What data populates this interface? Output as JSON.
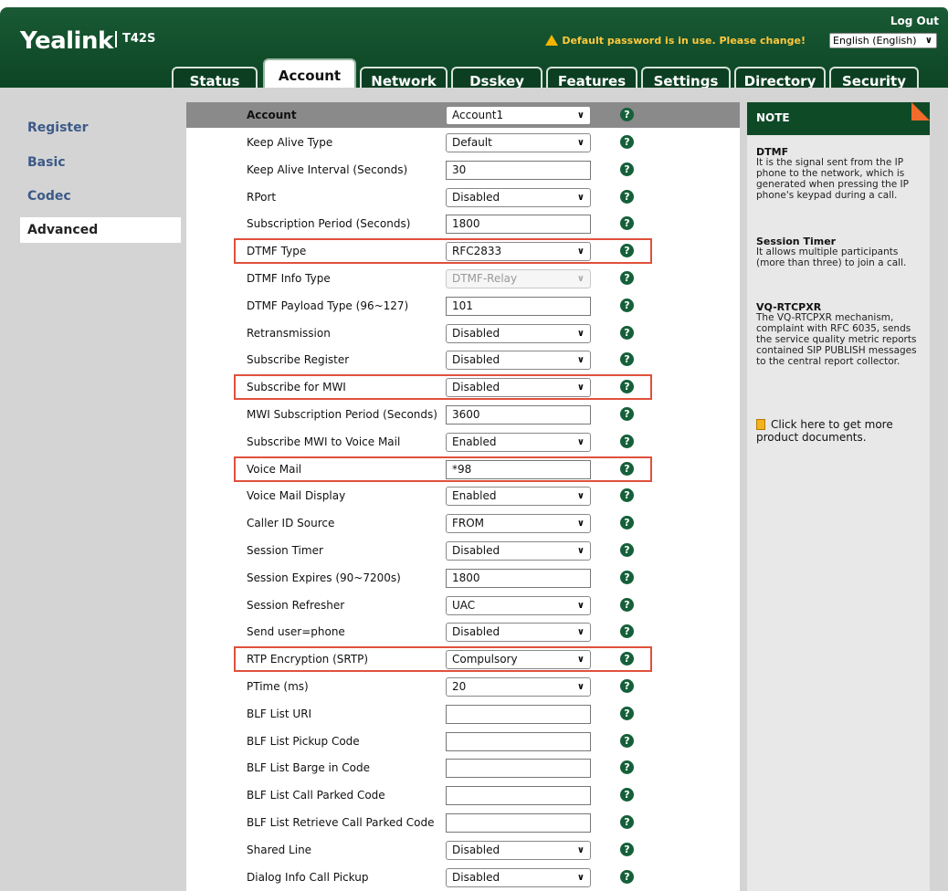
{
  "header": {
    "logo": "Yealink",
    "model": "T42S",
    "logout": "Log Out",
    "warning": "Default password is in use. Please change!",
    "language": "English (English)",
    "tabs": [
      "Status",
      "Account",
      "Network",
      "Dsskey",
      "Features",
      "Settings",
      "Directory",
      "Security"
    ],
    "active_tab": "Account"
  },
  "sidebar": {
    "items": [
      "Register",
      "Basic",
      "Codec",
      "Advanced"
    ],
    "active": "Advanced"
  },
  "form": {
    "account_label": "Account",
    "account_value": "Account1",
    "rows": [
      {
        "label": "Keep Alive Type",
        "value": "Default",
        "kind": "select"
      },
      {
        "label": "Keep Alive Interval (Seconds)",
        "value": "30",
        "kind": "input"
      },
      {
        "label": "RPort",
        "value": "Disabled",
        "kind": "select"
      },
      {
        "label": "Subscription Period (Seconds)",
        "value": "1800",
        "kind": "input"
      },
      {
        "label": "DTMF Type",
        "value": "RFC2833",
        "kind": "select",
        "highlight": true
      },
      {
        "label": "DTMF Info Type",
        "value": "DTMF-Relay",
        "kind": "select",
        "disabled": true
      },
      {
        "label": "DTMF Payload Type (96~127)",
        "value": "101",
        "kind": "input"
      },
      {
        "label": "Retransmission",
        "value": "Disabled",
        "kind": "select"
      },
      {
        "label": "Subscribe Register",
        "value": "Disabled",
        "kind": "select"
      },
      {
        "label": "Subscribe for MWI",
        "value": "Disabled",
        "kind": "select",
        "highlight": true
      },
      {
        "label": "MWI Subscription Period (Seconds)",
        "value": "3600",
        "kind": "input"
      },
      {
        "label": "Subscribe MWI to Voice Mail",
        "value": "Enabled",
        "kind": "select"
      },
      {
        "label": "Voice Mail",
        "value": "*98",
        "kind": "input",
        "highlight": true
      },
      {
        "label": "Voice Mail Display",
        "value": "Enabled",
        "kind": "select"
      },
      {
        "label": "Caller ID Source",
        "value": "FROM",
        "kind": "select"
      },
      {
        "label": "Session Timer",
        "value": "Disabled",
        "kind": "select"
      },
      {
        "label": "Session Expires (90~7200s)",
        "value": "1800",
        "kind": "input"
      },
      {
        "label": "Session Refresher",
        "value": "UAC",
        "kind": "select"
      },
      {
        "label": "Send user=phone",
        "value": "Disabled",
        "kind": "select"
      },
      {
        "label": "RTP Encryption (SRTP)",
        "value": "Compulsory",
        "kind": "select",
        "highlight": true
      },
      {
        "label": "PTime (ms)",
        "value": "20",
        "kind": "select"
      },
      {
        "label": "BLF List URI",
        "value": "",
        "kind": "input"
      },
      {
        "label": "BLF List Pickup Code",
        "value": "",
        "kind": "input"
      },
      {
        "label": "BLF List Barge in Code",
        "value": "",
        "kind": "input"
      },
      {
        "label": "BLF List Call Parked Code",
        "value": "",
        "kind": "input"
      },
      {
        "label": "BLF List Retrieve Call Parked Code",
        "value": "",
        "kind": "input"
      },
      {
        "label": "Shared Line",
        "value": "Disabled",
        "kind": "select"
      },
      {
        "label": "Dialog Info Call Pickup",
        "value": "Disabled",
        "kind": "select"
      }
    ],
    "help_glyph": "?"
  },
  "note": {
    "title": "NOTE",
    "sections": [
      {
        "heading": "DTMF",
        "text": "It is the signal sent from the IP phone to the network, which is generated when pressing the IP phone's keypad during a call."
      },
      {
        "heading": "Session Timer",
        "text": "It allows multiple participants (more than three) to join a call."
      },
      {
        "heading": "VQ-RTCPXR",
        "text": "The VQ-RTCPXR mechanism, complaint with RFC 6035, sends the service quality metric reports contained SIP PUBLISH messages to the central report collector."
      }
    ],
    "doc_link": "Click here to get more product documents."
  },
  "colors": {
    "brand_green": "#0f4a27",
    "highlight": "#e0513c",
    "warning": "#ffc93d"
  }
}
